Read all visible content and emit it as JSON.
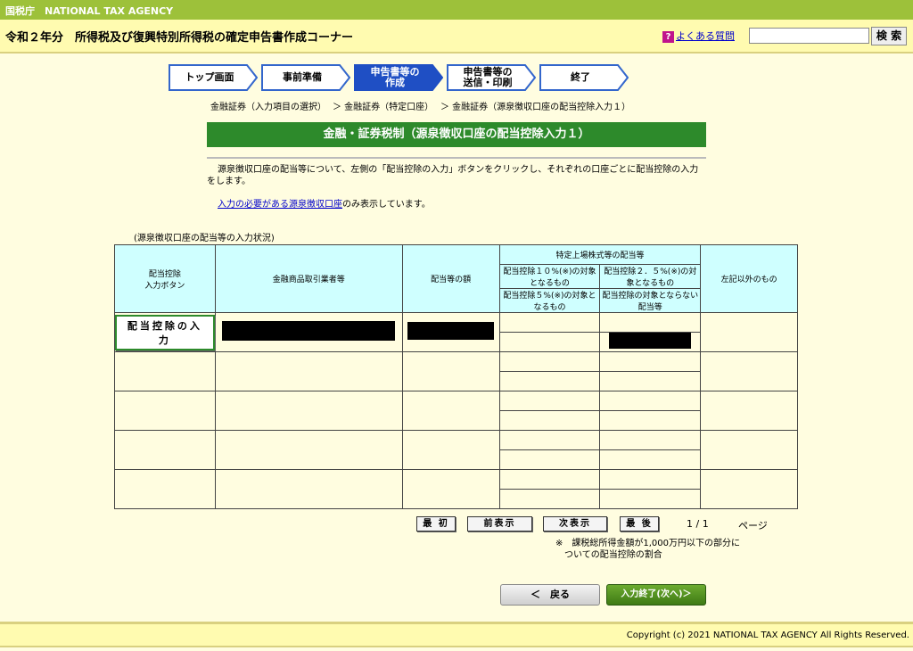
{
  "topbar": {
    "agency": "国税庁　NATIONAL TAX AGENCY"
  },
  "header": {
    "title": "令和２年分　所得税及び復興特別所得税の確定申告書作成コーナー",
    "faq": "よくある質問",
    "faq_icon": "?",
    "search_label": "検 索"
  },
  "steps": [
    {
      "label": "トップ画面"
    },
    {
      "label": "事前準備"
    },
    {
      "label": "申告書等の\n作成",
      "active": true
    },
    {
      "label": "申告書等の\n送信・印刷"
    },
    {
      "label": "終了"
    }
  ],
  "breadcrumb": [
    "金融証券（入力項目の選択）",
    "＞ 金融証券（特定口座）",
    "＞ 金融証券（源泉徴収口座の配当控除入力１）"
  ],
  "page_title": "金融・証券税制（源泉徴収口座の配当控除入力１）",
  "description": "源泉徴収口座の配当等について、左側の「配当控除の入力」ボタンをクリックし、それぞれの口座ごとに配当控除の入力をします。",
  "note": {
    "link": "入力の必要がある源泉徴収口座",
    "rest": "のみ表示しています。"
  },
  "table": {
    "caption": "(源泉徴収口座の配当等の入力状況)",
    "headers": {
      "button_col": "配当控除\n入力ボタン",
      "broker": "金融商品取引業者等",
      "amount": "配当等の額",
      "listed_group": "特定上場株式等の配当等",
      "rate10": "配当控除１０%(※)の対象となるもの",
      "rate25": "配当控除２．５%(※)の対象となるもの",
      "rate5": "配当控除５%(※)の対象となるもの",
      "none": "配当控除の対象とならない配当等",
      "other": "左記以外のもの"
    },
    "input_button": "配当控除の入力"
  },
  "pagination": {
    "first": "最 初",
    "prev": "前表示",
    "next": "次表示",
    "last": "最 後",
    "page": "1 / 1",
    "page_label": "ページ"
  },
  "footnote": "※　課税総所得金額が1,000万円以下の部分に\n　ついての配当控除の割合",
  "buttons": {
    "back": "＜　戻る",
    "next": "入力終了(次へ)＞"
  },
  "footer": "Copyright (c) 2021 NATIONAL TAX AGENCY All Rights Reserved."
}
